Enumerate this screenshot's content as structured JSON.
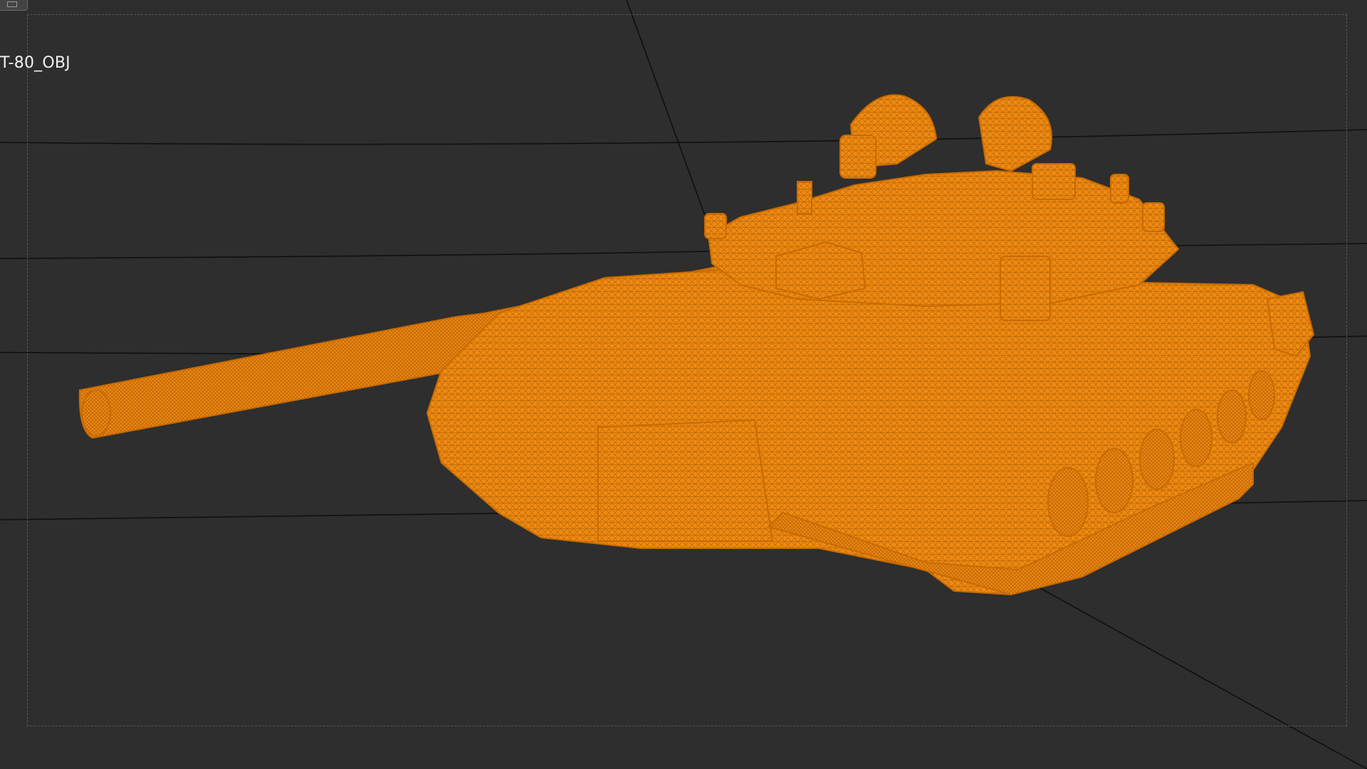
{
  "viewport": {
    "object_label": "T-80_OBJ",
    "model_color": "#f08a10",
    "wire_color": "#7a3f00",
    "background_color": "#2e2e2e",
    "grid_line_color": "#0d0d0d"
  },
  "icons": {
    "frame_toggle": "frame-toggle-icon",
    "model": "tank-wireframe-model"
  }
}
